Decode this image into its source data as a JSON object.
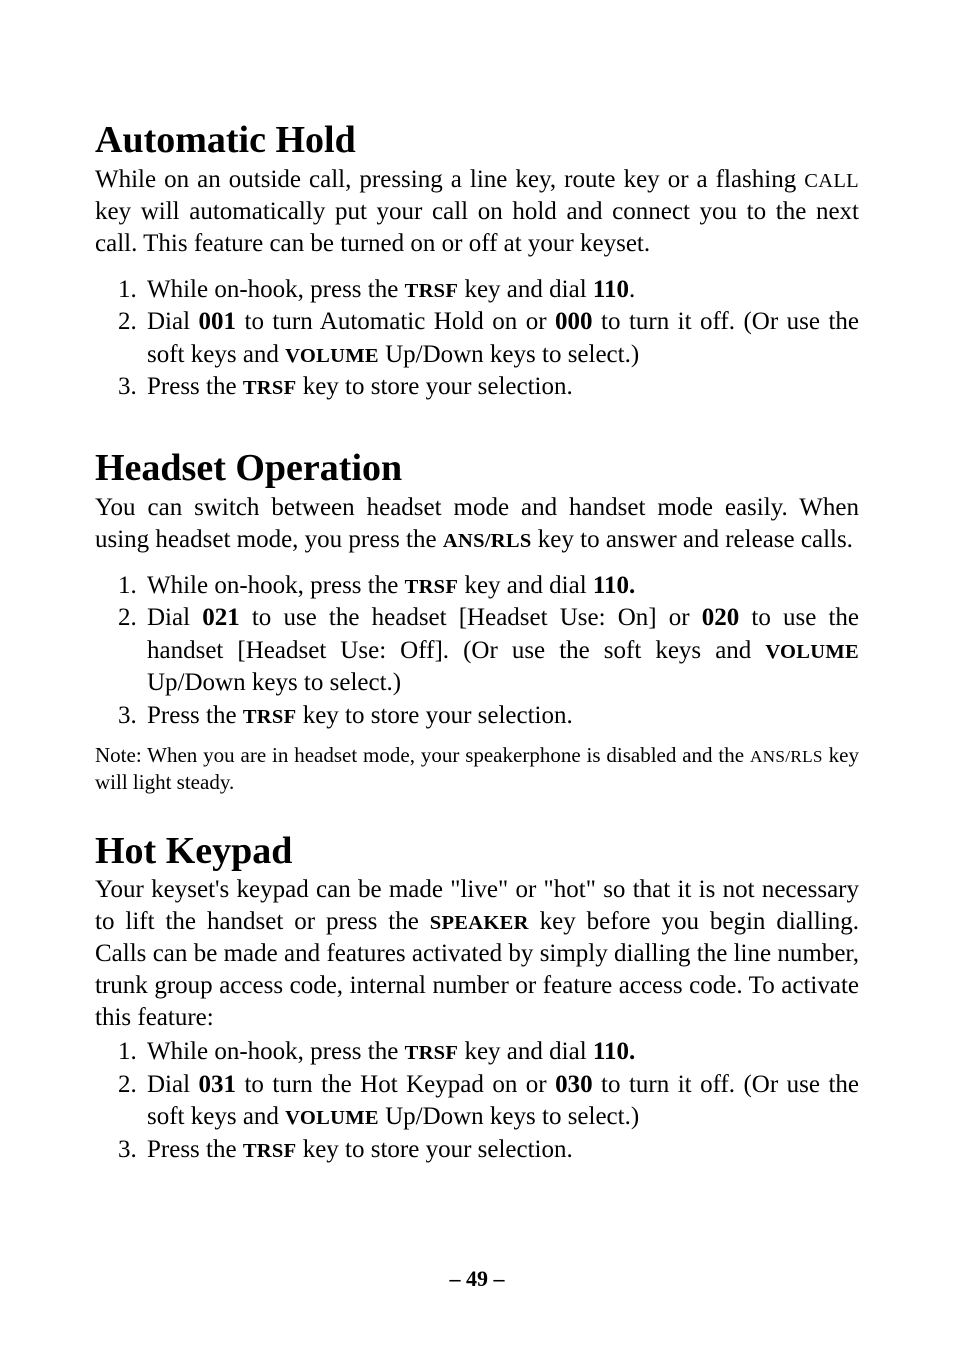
{
  "footer": {
    "page_number": "– 49 –"
  },
  "sections": [
    {
      "title": "Automatic Hold",
      "intro_parts": [
        {
          "t": "While on an outside call, pressing a line key, route key or a flashing "
        },
        {
          "t": "CALL",
          "sc": true
        },
        {
          "t": " key will automatically put your call on hold and connect you to the next call. This feature can be turned on or off at your keyset."
        }
      ],
      "steps": [
        [
          {
            "t": "While on-hook, press the "
          },
          {
            "t": "TRSF",
            "sc": true,
            "b": true
          },
          {
            "t": " key and dial "
          },
          {
            "t": "110",
            "b": true
          },
          {
            "t": "."
          }
        ],
        [
          {
            "t": "Dial "
          },
          {
            "t": "001",
            "b": true
          },
          {
            "t": " to turn Automatic Hold on or "
          },
          {
            "t": "000",
            "b": true
          },
          {
            "t": " to turn it off. (Or use the soft keys and "
          },
          {
            "t": "VOLUME",
            "sc": true,
            "b": true
          },
          {
            "t": " Up/Down keys to select.)"
          }
        ],
        [
          {
            "t": "Press the "
          },
          {
            "t": "TRSF",
            "sc": true,
            "b": true
          },
          {
            "t": " key to store your selection."
          }
        ]
      ],
      "note_parts": null
    },
    {
      "title": "Headset Operation",
      "intro_parts": [
        {
          "t": "You can switch between headset mode and handset mode easily. When using headset mode, you press the "
        },
        {
          "t": "ANS/RLS",
          "sc": true,
          "b": true
        },
        {
          "t": " key to answer and release calls."
        }
      ],
      "steps": [
        [
          {
            "t": "While on-hook, press the "
          },
          {
            "t": "TRSF",
            "sc": true,
            "b": true
          },
          {
            "t": " key and dial "
          },
          {
            "t": "110.",
            "b": true
          }
        ],
        [
          {
            "t": "Dial "
          },
          {
            "t": "021",
            "b": true
          },
          {
            "t": " to use the headset [Headset Use: On] or "
          },
          {
            "t": "020",
            "b": true
          },
          {
            "t": " to use the handset [Headset Use: Off]. (Or use the soft keys and "
          },
          {
            "t": "VOLUME",
            "sc": true,
            "b": true
          },
          {
            "t": " Up/Down keys to select.)"
          }
        ],
        [
          {
            "t": "Press the "
          },
          {
            "t": "TRSF",
            "sc": true,
            "b": true
          },
          {
            "t": " key to store your selection."
          }
        ]
      ],
      "note_parts": [
        {
          "t": "Note: When you are in headset mode, your speakerphone is disabled and the "
        },
        {
          "t": "ANS/RLS",
          "sc": true
        },
        {
          "t": " key will light steady."
        }
      ]
    },
    {
      "title": "Hot Keypad",
      "intro_parts": [
        {
          "t": "Your keyset's keypad can be made \"live\" or \"hot\" so that it is not necessary to lift the handset or press the "
        },
        {
          "t": "SPEAKER",
          "sc": true,
          "b": true
        },
        {
          "t": " key before you begin dialling. Calls can be made and features activated by simply dialling the line number, trunk group access code, internal number or feature access code. To activate this feature:"
        }
      ],
      "steps": [
        [
          {
            "t": "While on-hook, press the "
          },
          {
            "t": "TRSF",
            "sc": true,
            "b": true
          },
          {
            "t": " key and dial "
          },
          {
            "t": "110.",
            "b": true
          }
        ],
        [
          {
            "t": "Dial "
          },
          {
            "t": "031",
            "b": true
          },
          {
            "t": " to turn the Hot Keypad on or "
          },
          {
            "t": "030",
            "b": true
          },
          {
            "t": " to turn it off. (Or use the soft keys and "
          },
          {
            "t": "VOLUME",
            "sc": true,
            "b": true
          },
          {
            "t": " Up/Down keys to select.)"
          }
        ],
        [
          {
            "t": "Press the "
          },
          {
            "t": "TRSF",
            "sc": true,
            "b": true
          },
          {
            "t": " key to store your selection."
          }
        ]
      ],
      "note_parts": null
    }
  ]
}
